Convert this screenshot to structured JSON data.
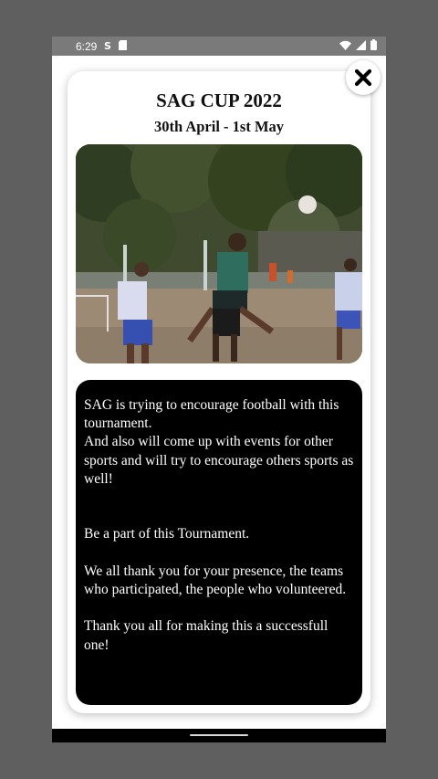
{
  "status_bar": {
    "time": "6:29",
    "left_icons": [
      "sync-icon",
      "sd-card-icon"
    ],
    "right_icons": [
      "wifi-icon",
      "signal-icon",
      "battery-icon"
    ]
  },
  "dialog": {
    "title": "SAG CUP 2022",
    "subtitle": "30th April - 1st May",
    "image_alt": "Football match photo",
    "message": " SAG is trying to encourage football with this tournament.\nAnd also will come up with events for other sports and will try to encourage others sports as well!\n\n\nBe a part of this Tournament.\n\nWe all thank you for your presence, the teams who participated, the people who volunteered.\n\nThank you all for making this a successfull one!",
    "close_icon": "close-icon"
  },
  "colors": {
    "background": "#5f5f5f",
    "status_bar": "#7a7a7a",
    "card": "#ffffff",
    "message_box": "#000000",
    "text_dark": "#111111",
    "text_light": "#ffffff"
  }
}
